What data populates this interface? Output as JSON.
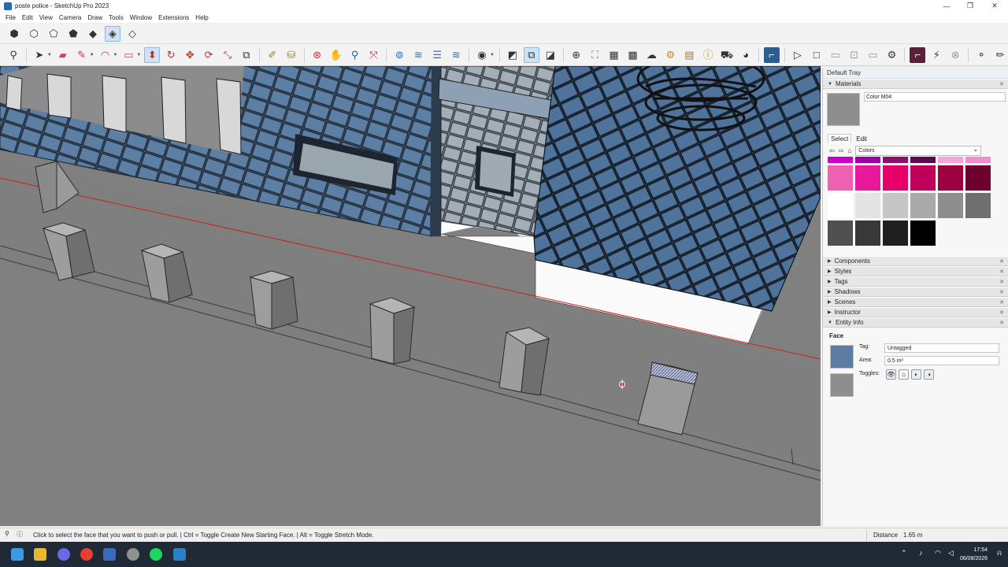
{
  "window": {
    "title": "poste police - SketchUp Pro 2023",
    "minimize_glyph": "—",
    "maximize_glyph": "❐",
    "close_glyph": "✕"
  },
  "menu": [
    "File",
    "Edit",
    "View",
    "Camera",
    "Draw",
    "Tools",
    "Window",
    "Extensions",
    "Help"
  ],
  "tray": {
    "title": "Default Tray",
    "materials": {
      "header": "Materials",
      "current_name": "Color M04",
      "tab_select": "Select",
      "tab_edit": "Edit",
      "library": "Colors",
      "swatch_colors": [
        [
          "#cc00cc",
          "#9a00a8",
          "#8a0f6e",
          "#5a0a4a",
          "#f5a6d8",
          "#f08ccf"
        ],
        [
          "#f060b0",
          "#e8189a",
          "#e8006a",
          "#c0005a",
          "#9c0040",
          "#6e0030"
        ],
        [
          "#ffffff",
          "#e4e4e4",
          "#c6c6c6",
          "#a9a9a9",
          "#8e8e8e",
          "#6f6f6f"
        ],
        [
          "#505050",
          "#383838",
          "#1f1f1f",
          "#000000"
        ]
      ]
    },
    "panels": [
      "Components",
      "Styles",
      "Tags",
      "Shadows",
      "Scenes",
      "Instructor"
    ],
    "entity_info": {
      "header": "Entity Info",
      "type": "Face",
      "tag_label": "Tag:",
      "tag_value": "Untagged",
      "area_label": "Area:",
      "area_value": "0.5 m²",
      "toggles_label": "Toggles:",
      "front_color": "#5c7da0",
      "back_color": "#8e8e8e"
    }
  },
  "status": {
    "hint": "Click to select the face that you want to push or pull. | Ctrl = Toggle Create New Starting Face. | Alt = Toggle Stretch Mode.",
    "distance_label": "Distance",
    "distance_value": "1.65 m"
  },
  "taskbar": {
    "time": "17:54",
    "date": "06/08/2026"
  }
}
